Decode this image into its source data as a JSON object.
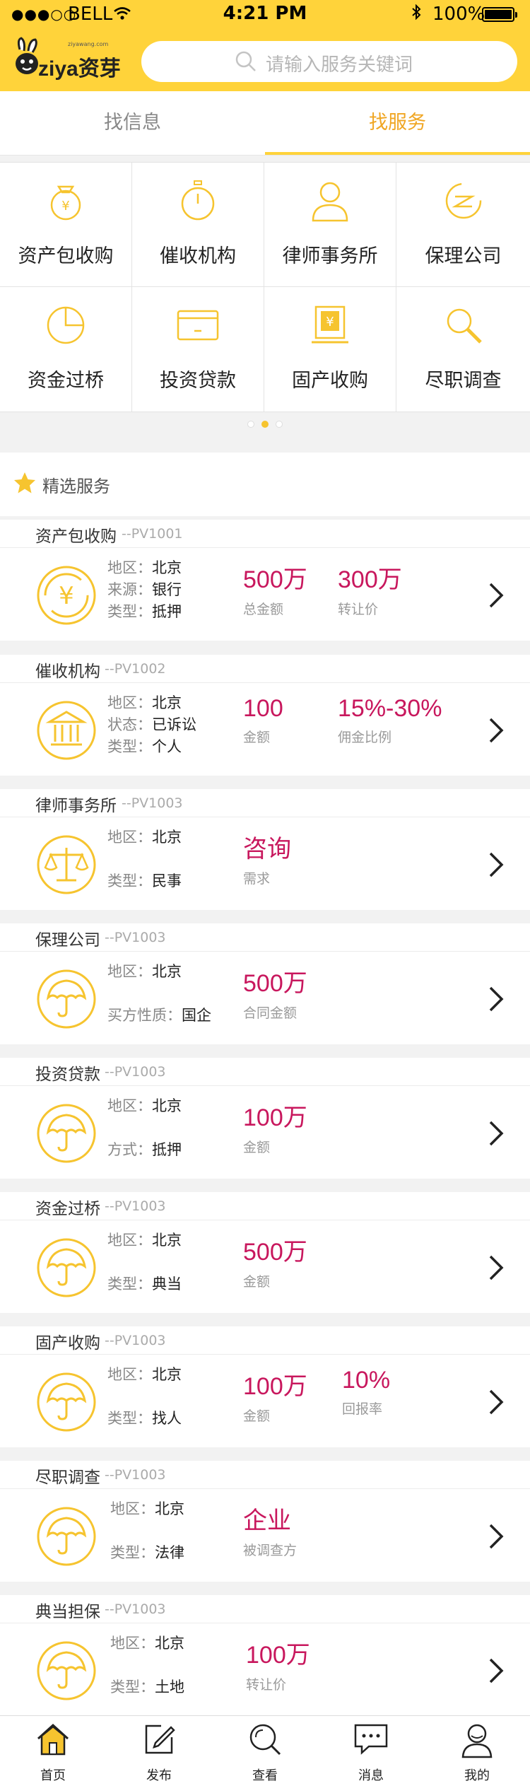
{
  "status_bar": {
    "carrier": "BELL",
    "time": "4:21 PM",
    "battery": "100%"
  },
  "brand": {
    "name": "ziya资芽",
    "sub": "ziyawang.com"
  },
  "search": {
    "placeholder": "请输入服务关键词"
  },
  "tabs": [
    {
      "label": "找信息"
    },
    {
      "label": "找服务",
      "active": true
    }
  ],
  "categories": [
    {
      "label": "资产包收购",
      "icon": "money-bag-icon"
    },
    {
      "label": "催收机构",
      "icon": "stopwatch-icon"
    },
    {
      "label": "律师事务所",
      "icon": "person-icon"
    },
    {
      "label": "保理公司",
      "icon": "swirl-icon"
    },
    {
      "label": "资金过桥",
      "icon": "pie-chart-icon"
    },
    {
      "label": "投资贷款",
      "icon": "card-icon"
    },
    {
      "label": "固产收购",
      "icon": "yuan-building-icon"
    },
    {
      "label": "尽职调查",
      "icon": "magnifier-icon"
    }
  ],
  "pager": {
    "pages": 3,
    "current": 2
  },
  "section": {
    "title": "精选服务"
  },
  "services": [
    {
      "title": "资产包收购",
      "code": "--PV1001",
      "icon": "yuan-cycle-icon",
      "rows": [
        {
          "k": "地区：",
          "v": "北京"
        },
        {
          "k": "来源：",
          "v": "银行"
        },
        {
          "k": "类型：",
          "v": "抵押"
        }
      ],
      "stats": [
        {
          "value": "500万",
          "label": "总金额"
        },
        {
          "value": "300万",
          "label": "转让价"
        }
      ]
    },
    {
      "title": "催收机构",
      "code": "--PV1002",
      "icon": "bank-icon",
      "rows": [
        {
          "k": "地区：",
          "v": "北京"
        },
        {
          "k": "状态：",
          "v": "已诉讼"
        },
        {
          "k": "类型：",
          "v": "个人"
        }
      ],
      "stats": [
        {
          "value": "100",
          "label": "金额"
        },
        {
          "value": "15%-30%",
          "label": "佣金比例"
        }
      ]
    },
    {
      "title": "律师事务所",
      "code": "--PV1003",
      "icon": "scales-icon",
      "rows": [
        {
          "k": "地区：",
          "v": "北京"
        },
        {
          "k": "",
          "v": ""
        },
        {
          "k": "类型：",
          "v": "民事"
        }
      ],
      "stats": [
        {
          "value": "咨询",
          "label": "需求"
        }
      ]
    },
    {
      "title": "保理公司",
      "code": "--PV1003",
      "icon": "umbrella-icon",
      "rows": [
        {
          "k": "地区：",
          "v": "北京"
        },
        {
          "k": "",
          "v": ""
        },
        {
          "k": "买方性质：",
          "v": "国企"
        }
      ],
      "stats": [
        {
          "value": "500万",
          "label": "合同金额"
        }
      ]
    },
    {
      "title": "投资贷款",
      "code": "--PV1003",
      "icon": "umbrella-icon",
      "rows": [
        {
          "k": "地区：",
          "v": "北京"
        },
        {
          "k": "",
          "v": ""
        },
        {
          "k": "方式：",
          "v": "抵押"
        }
      ],
      "stats": [
        {
          "value": "100万",
          "label": "金额"
        }
      ]
    },
    {
      "title": "资金过桥",
      "code": "--PV1003",
      "icon": "umbrella-icon",
      "rows": [
        {
          "k": "地区：",
          "v": "北京"
        },
        {
          "k": "",
          "v": ""
        },
        {
          "k": "类型：",
          "v": "典当"
        }
      ],
      "stats": [
        {
          "value": "500万",
          "label": "金额"
        }
      ]
    },
    {
      "title": "固产收购",
      "code": "--PV1003",
      "icon": "umbrella-icon",
      "rows": [
        {
          "k": "地区：",
          "v": "北京"
        },
        {
          "k": "",
          "v": ""
        },
        {
          "k": "类型：",
          "v": "找人"
        }
      ],
      "stats": [
        {
          "value": "100万",
          "label": "金额"
        },
        {
          "value": "10%",
          "label": "回报率"
        }
      ]
    },
    {
      "title": "尽职调查",
      "code": "--PV1003",
      "icon": "umbrella-icon",
      "rows": [
        {
          "k": "地区：",
          "v": "北京"
        },
        {
          "k": "",
          "v": ""
        },
        {
          "k": "类型：",
          "v": "法律"
        }
      ],
      "stats": [
        {
          "value": "企业",
          "label": "被调查方"
        }
      ]
    },
    {
      "title": "典当担保",
      "code": "--PV1003",
      "icon": "umbrella-icon",
      "rows": [
        {
          "k": "地区：",
          "v": "北京"
        },
        {
          "k": "",
          "v": ""
        },
        {
          "k": "类型：",
          "v": "土地"
        }
      ],
      "stats": [
        {
          "value": "100万",
          "label": "转让价"
        }
      ]
    }
  ],
  "tabbar": [
    {
      "label": "首页",
      "icon": "home-icon",
      "active": true
    },
    {
      "label": "发布",
      "icon": "edit-icon"
    },
    {
      "label": "查看",
      "icon": "search-icon"
    },
    {
      "label": "消息",
      "icon": "message-icon"
    },
    {
      "label": "我的",
      "icon": "profile-icon"
    }
  ],
  "colors": {
    "brand_yellow": "#ffd33a",
    "accent_orange": "#f0a623",
    "value_red": "#c8175d"
  }
}
